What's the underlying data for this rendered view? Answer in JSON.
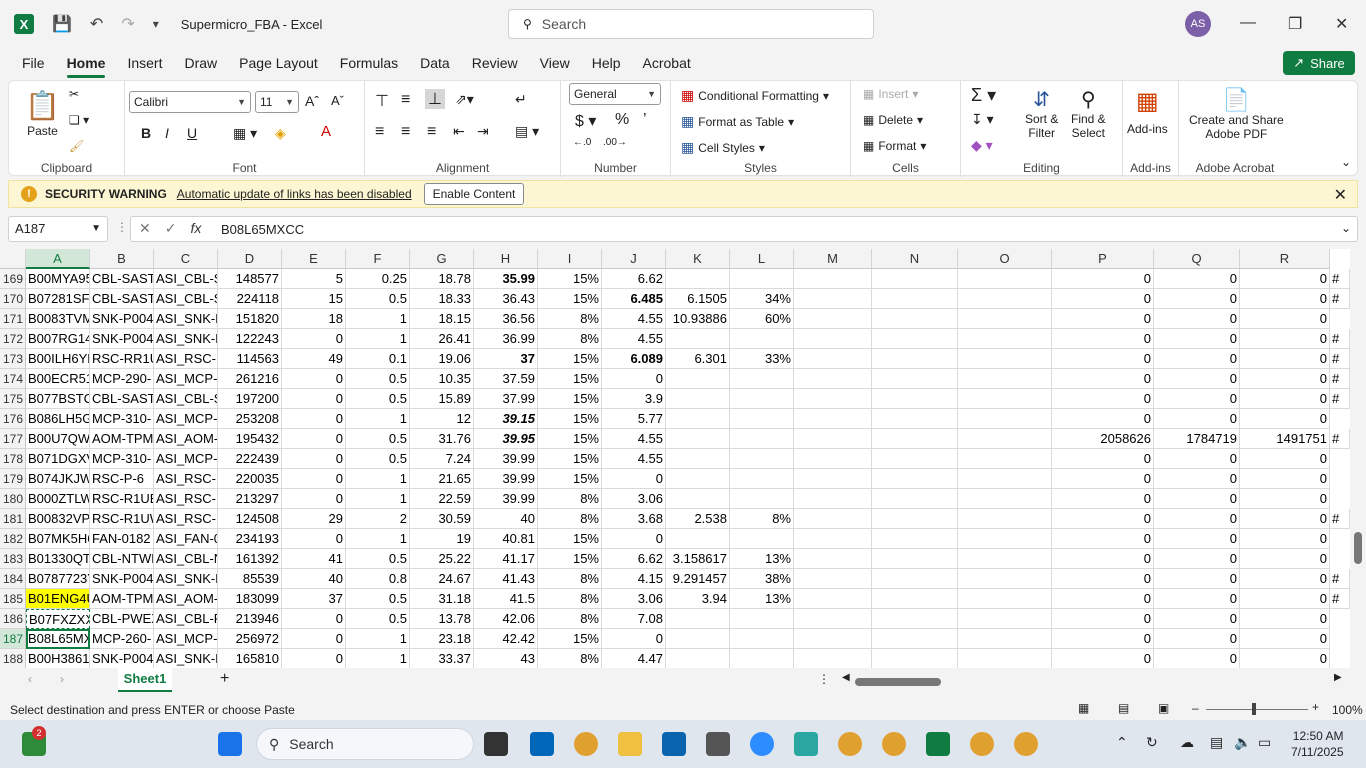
{
  "window": {
    "title": "Supermicro_FBA  -  Excel",
    "search_placeholder": "Search",
    "avatar_initials": "AS",
    "share_label": "Share"
  },
  "tabs": [
    "File",
    "Home",
    "Insert",
    "Draw",
    "Page Layout",
    "Formulas",
    "Data",
    "Review",
    "View",
    "Help",
    "Acrobat"
  ],
  "ribbon": {
    "clipboard": {
      "paste": "Paste",
      "label": "Clipboard"
    },
    "font": {
      "name": "Calibri",
      "size": "11",
      "label": "Font",
      "bold": "B",
      "italic": "I",
      "underline": "U"
    },
    "alignment": {
      "label": "Alignment"
    },
    "number": {
      "format": "General",
      "label": "Number"
    },
    "styles": {
      "conditional": "Conditional Formatting",
      "table": "Format as Table",
      "cell_styles": "Cell Styles",
      "label": "Styles"
    },
    "cells": {
      "insert": "Insert",
      "delete": "Delete",
      "format": "Format",
      "label": "Cells"
    },
    "editing": {
      "sort": "Sort &",
      "sort2": "Filter",
      "find": "Find &",
      "find2": "Select",
      "label": "Editing"
    },
    "addins": {
      "button": "Add-ins",
      "label": "Add-ins"
    },
    "acrobat": {
      "button1": "Create and Share",
      "button2": "Adobe PDF",
      "label": "Adobe Acrobat"
    }
  },
  "security": {
    "title": "SECURITY WARNING",
    "message": "Automatic update of links has been disabled",
    "button": "Enable Content"
  },
  "formula_bar": {
    "name_box": "A187",
    "value": "B08L65MXCC"
  },
  "columns": [
    "A",
    "B",
    "C",
    "D",
    "E",
    "F",
    "G",
    "H",
    "I",
    "J",
    "K",
    "L",
    "M",
    "N",
    "O",
    "P",
    "Q",
    "R"
  ],
  "rows": [
    {
      "n": "169",
      "c": [
        "B00MYA95",
        "CBL-SAST-",
        "ASI_CBL-S",
        "148577",
        "5",
        "0.25",
        "18.78",
        "35.99",
        "15%",
        "6.62",
        "",
        "",
        "",
        "",
        "",
        "0",
        "0",
        "0",
        "#"
      ]
    },
    {
      "n": "170",
      "c": [
        "B07281SFN",
        "CBL-SAST-",
        "ASI_CBL-S",
        "224118",
        "15",
        "0.5",
        "18.33",
        "36.43",
        "15%",
        "6.485",
        "6.1505",
        "34%",
        "",
        "",
        "",
        "0",
        "0",
        "0",
        "#"
      ]
    },
    {
      "n": "171",
      "c": [
        "B0083TVM",
        "SNK-P004",
        "ASI_SNK-P",
        "151820",
        "18",
        "1",
        "18.15",
        "36.56",
        "8%",
        "4.55",
        "10.93886",
        "60%",
        "",
        "",
        "",
        "0",
        "0",
        "0",
        ""
      ]
    },
    {
      "n": "172",
      "c": [
        "B007RG14",
        "SNK-P004",
        "ASI_SNK-P",
        "122243",
        "0",
        "1",
        "26.41",
        "36.99",
        "8%",
        "4.55",
        "",
        "",
        "",
        "",
        "",
        "0",
        "0",
        "0",
        "#"
      ]
    },
    {
      "n": "173",
      "c": [
        "B00ILH6YK",
        "RSC-RR1U",
        "ASI_RSC-R",
        "114563",
        "49",
        "0.1",
        "19.06",
        "37",
        "15%",
        "6.089",
        "6.301",
        "33%",
        "",
        "",
        "",
        "0",
        "0",
        "0",
        "#"
      ]
    },
    {
      "n": "174",
      "c": [
        "B00ECR51",
        "MCP-290-",
        "ASI_MCP-",
        "261216",
        "0",
        "0.5",
        "10.35",
        "37.59",
        "15%",
        "0",
        "",
        "",
        "",
        "",
        "",
        "0",
        "0",
        "0",
        "#"
      ]
    },
    {
      "n": "175",
      "c": [
        "B077BSTC",
        "CBL-SAST-",
        "ASI_CBL-S",
        "197200",
        "0",
        "0.5",
        "15.89",
        "37.99",
        "15%",
        "3.9",
        "",
        "",
        "",
        "",
        "",
        "0",
        "0",
        "0",
        "#"
      ]
    },
    {
      "n": "176",
      "c": [
        "B086LH5G",
        "MCP-310-",
        "ASI_MCP-",
        "253208",
        "0",
        "1",
        "12",
        "39.15",
        "15%",
        "5.77",
        "",
        "",
        "",
        "",
        "",
        "0",
        "0",
        "0",
        ""
      ]
    },
    {
      "n": "177",
      "c": [
        "B00U7QW",
        "AOM-TPM",
        "ASI_AOM-",
        "195432",
        "0",
        "0.5",
        "31.76",
        "39.95",
        "15%",
        "4.55",
        "",
        "",
        "",
        "",
        "",
        "2058626",
        "1784719",
        "1491751",
        "#"
      ]
    },
    {
      "n": "178",
      "c": [
        "B071DGXV",
        "MCP-310-",
        "ASI_MCP-",
        "222439",
        "0",
        "0.5",
        "7.24",
        "39.99",
        "15%",
        "4.55",
        "",
        "",
        "",
        "",
        "",
        "0",
        "0",
        "0",
        ""
      ]
    },
    {
      "n": "179",
      "c": [
        "B074JKJW",
        "RSC-P-6",
        "ASI_RSC-P",
        "220035",
        "0",
        "1",
        "21.65",
        "39.99",
        "15%",
        "0",
        "",
        "",
        "",
        "",
        "",
        "0",
        "0",
        "0",
        ""
      ]
    },
    {
      "n": "180",
      "c": [
        "B000ZTLW",
        "RSC-R1UE",
        "ASI_RSC-R",
        "213297",
        "0",
        "1",
        "22.59",
        "39.99",
        "8%",
        "3.06",
        "",
        "",
        "",
        "",
        "",
        "0",
        "0",
        "0",
        ""
      ]
    },
    {
      "n": "181",
      "c": [
        "B00832VP",
        "RSC-R1UW",
        "ASI_RSC-R",
        "124508",
        "29",
        "2",
        "30.59",
        "40",
        "8%",
        "3.68",
        "2.538",
        "8%",
        "",
        "",
        "",
        "0",
        "0",
        "0",
        "#"
      ]
    },
    {
      "n": "182",
      "c": [
        "B07MK5H6",
        "FAN-0182",
        "ASI_FAN-0",
        "234193",
        "0",
        "1",
        "19",
        "40.81",
        "15%",
        "0",
        "",
        "",
        "",
        "",
        "",
        "0",
        "0",
        "0",
        ""
      ]
    },
    {
      "n": "183",
      "c": [
        "B01330QT",
        "CBL-NTWK",
        "ASI_CBL-N",
        "161392",
        "41",
        "0.5",
        "25.22",
        "41.17",
        "15%",
        "6.62",
        "3.158617",
        "13%",
        "",
        "",
        "",
        "0",
        "0",
        "0",
        ""
      ]
    },
    {
      "n": "184",
      "c": [
        "B0787723Y",
        "SNK-P004",
        "ASI_SNK-P",
        "85539",
        "40",
        "0.8",
        "24.67",
        "41.43",
        "8%",
        "4.15",
        "9.291457",
        "38%",
        "",
        "",
        "",
        "0",
        "0",
        "0",
        "#"
      ]
    },
    {
      "n": "185",
      "c": [
        "B01ENG4U",
        "AOM-TPM",
        "ASI_AOM-",
        "183099",
        "37",
        "0.5",
        "31.18",
        "41.5",
        "8%",
        "3.06",
        "3.94",
        "13%",
        "",
        "",
        "",
        "0",
        "0",
        "0",
        "#"
      ]
    },
    {
      "n": "186",
      "c": [
        "B07FXZXX",
        "CBL-PWEX",
        "ASI_CBL-P",
        "213946",
        "0",
        "0.5",
        "13.78",
        "42.06",
        "8%",
        "7.08",
        "",
        "",
        "",
        "",
        "",
        "0",
        "0",
        "0",
        ""
      ]
    },
    {
      "n": "187",
      "c": [
        "B08L65MX",
        "MCP-260-",
        "ASI_MCP-",
        "256972",
        "0",
        "1",
        "23.18",
        "42.42",
        "15%",
        "0",
        "",
        "",
        "",
        "",
        "",
        "0",
        "0",
        "0",
        ""
      ]
    },
    {
      "n": "188",
      "c": [
        "B00H3861",
        "SNK-P004",
        "ASI_SNK-P",
        "165810",
        "0",
        "1",
        "33.37",
        "43",
        "8%",
        "4.47",
        "",
        "",
        "",
        "",
        "",
        "0",
        "0",
        "0",
        ""
      ]
    }
  ],
  "sheet": {
    "name": "Sheet1",
    "add": "+"
  },
  "status": {
    "message": "Select destination and press ENTER or choose Paste",
    "zoom": "100%"
  },
  "taskbar": {
    "search": "Search",
    "time": "12:50 AM",
    "date": "7/11/2025",
    "badge": "2"
  }
}
